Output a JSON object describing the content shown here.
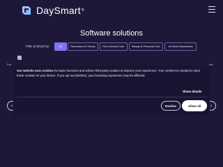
{
  "header": {
    "brand_name": "DaySmart",
    "brand_tm": "®",
    "menu_icon": "hamburger-icon",
    "logo_icon": "daysmart-logo-icon"
  },
  "title": "Software solutions",
  "filters": {
    "label": "Filter products by:",
    "options": [
      {
        "label": "All",
        "active": true
      },
      {
        "label": "Recreation & Fitness",
        "active": false
      },
      {
        "label": "Pet & Animal Care",
        "active": false
      },
      {
        "label": "Beauty & Personal Care",
        "active": false
      },
      {
        "label": "All Sized Businesses",
        "active": false
      }
    ]
  },
  "background": {
    "left_text": "For",
    "right_text": "ore"
  },
  "cookie_banner": {
    "bold_text": "Our website uses cookies",
    "text": " for basic functions and utilizes third-party cookies to improve your experience. Your consent is needed to store these cookies on your device. If you opt out (decline), your browsing experience may be affected.",
    "show_details_label": "Show details",
    "decline_label": "Decline",
    "allow_label": "Allow all"
  },
  "carousel": {
    "prev_icon": "chevron-left-icon",
    "next_icon": "chevron-right-icon",
    "prev_glyph": "‹",
    "next_glyph": "›"
  },
  "colors": {
    "background": "#1e1838",
    "accent": "#7d74f4",
    "banner": "#1a1433"
  }
}
